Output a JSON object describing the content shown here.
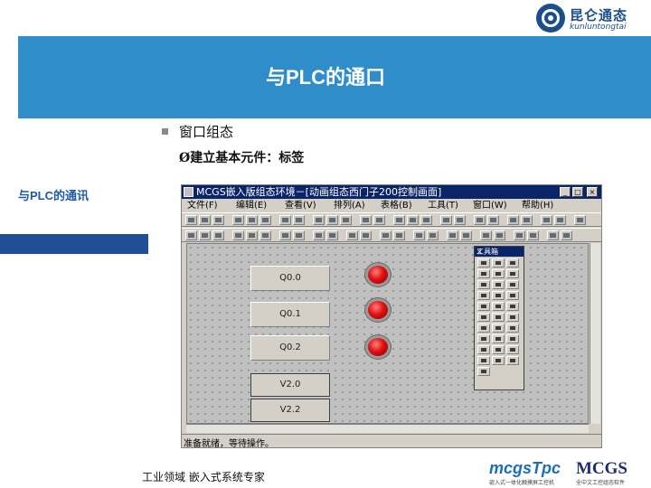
{
  "header": {
    "logo_cn": "昆仑通态",
    "logo_en": "kunluntongtai",
    "title": "与PLC的通口"
  },
  "content": {
    "bullet": "窗口组态",
    "sub_bullet": "Ø建立基本元件：标签",
    "side_label": "与PLC的通讯"
  },
  "app": {
    "window_title": "MCGS嵌入版组态环境－[动画组态西门子200控制画面]",
    "window_buttons": [
      "_",
      "□",
      "×"
    ],
    "menu": [
      "文件(F)",
      "编辑(E)",
      "查看(V)",
      "排列(A)",
      "表格(B)",
      "工具(T)",
      "窗口(W)",
      "帮助(H)"
    ],
    "labels": [
      "Q0.0",
      "Q0.1",
      "Q0.2",
      "V2.0",
      "V2.2"
    ],
    "toolbox_title": "工具箱",
    "toolbox_close": "×",
    "status": "准备就绪，等待操作。"
  },
  "footer": {
    "text": "工业领域   嵌入式系统专家",
    "brand_left": "mcgsTpc",
    "brand_left_sub": "嵌入式一体化触摸屏工控机",
    "brand_right": "MCGS",
    "brand_right_sub": "全中文工控组态软件"
  },
  "colors": {
    "header_band": "#2f8ec9",
    "side_bar": "#1f4f97",
    "title_bar": "#0a246a",
    "lamp_red": "#e01010"
  }
}
